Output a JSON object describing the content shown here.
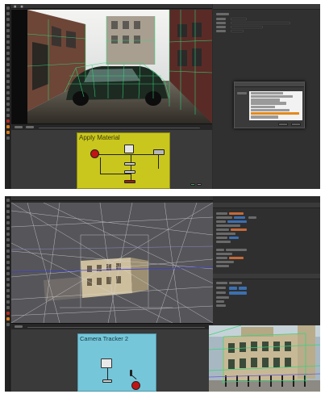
{
  "top_screenshot": {
    "backdrop_label": "Apply Material",
    "accent_color": "#c9c61e",
    "dialog": {
      "highlighted_item_color": "#e48a1a"
    }
  },
  "bottom_screenshot": {
    "backdrop_label": "Camera Tracker 2",
    "accent_color": "#76c6d9"
  },
  "icons": [
    "camera-node-icon",
    "read-node-icon",
    "viewer-node-icon",
    "write-node-icon"
  ]
}
